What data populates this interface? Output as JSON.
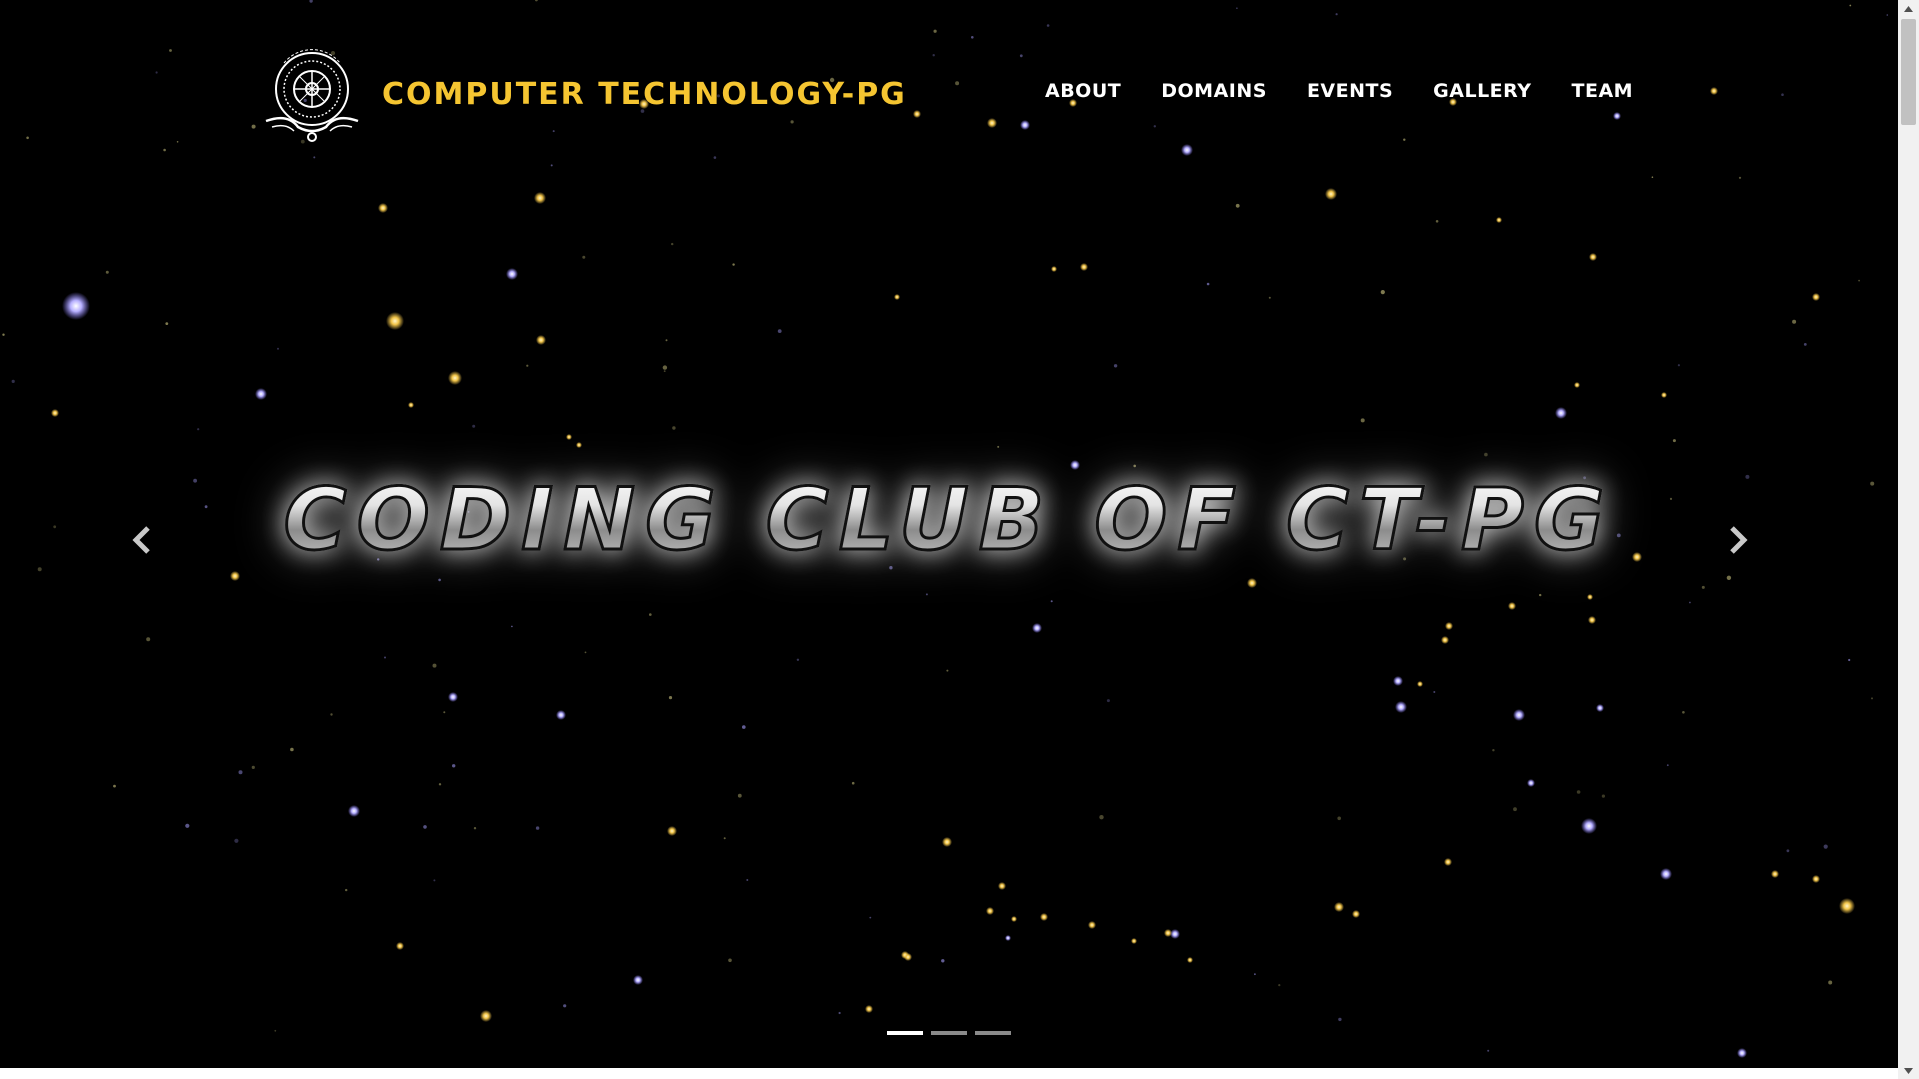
{
  "site": {
    "brand_name": "COMPUTER TECHNOLOGY-PG",
    "logo_icon": "association-seal-logo",
    "brand_color": "#f5c531"
  },
  "nav": {
    "items": [
      {
        "label": "ABOUT"
      },
      {
        "label": "DOMAINS"
      },
      {
        "label": "EVENTS"
      },
      {
        "label": "GALLERY"
      },
      {
        "label": "TEAM"
      }
    ]
  },
  "carousel": {
    "slide_title": "CODING CLUB OF CT-PG",
    "prev_icon": "chevron-left-icon",
    "next_icon": "chevron-right-icon",
    "slide_count": 3,
    "active_index": 0
  },
  "theme": {
    "background": "#000000",
    "star_gold": "#f3c64a",
    "star_violet": "#a9a4ff"
  }
}
